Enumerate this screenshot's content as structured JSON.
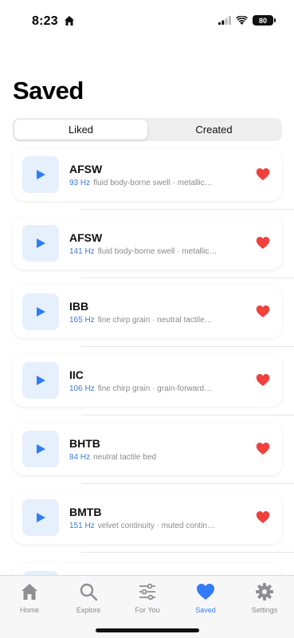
{
  "status": {
    "time": "8:23",
    "battery": "80"
  },
  "page": {
    "title": "Saved"
  },
  "segments": [
    {
      "label": "Liked",
      "active": true
    },
    {
      "label": "Created",
      "active": false
    }
  ],
  "items": [
    {
      "title": "AFSW",
      "hz": "93 Hz",
      "desc": "fluid body-borne swell · metallic…"
    },
    {
      "title": "AFSW",
      "hz": "141 Hz",
      "desc": "fluid body-borne swell · metallic…"
    },
    {
      "title": "IBB",
      "hz": "165 Hz",
      "desc": "fine chirp grain · neutral tactile…"
    },
    {
      "title": "IIC",
      "hz": "106 Hz",
      "desc": "fine chirp grain · grain-forward…"
    },
    {
      "title": "BHTB",
      "hz": "84 Hz",
      "desc": "neutral tactile bed"
    },
    {
      "title": "BMTB",
      "hz": "151 Hz",
      "desc": "velvet continuity · muted contin…"
    }
  ],
  "tabs": [
    {
      "label": "Home",
      "icon": "house-icon",
      "active": false
    },
    {
      "label": "Explore",
      "icon": "magnifier-icon",
      "active": false
    },
    {
      "label": "For You",
      "icon": "sliders-icon",
      "active": false
    },
    {
      "label": "Saved",
      "icon": "heart-icon",
      "active": true
    },
    {
      "label": "Settings",
      "icon": "gear-icon",
      "active": false
    }
  ],
  "colors": {
    "accent": "#2f7cf6",
    "heart": "#f0413c",
    "hz": "#3a7bd5",
    "play_bg": "#e6f0fc"
  }
}
